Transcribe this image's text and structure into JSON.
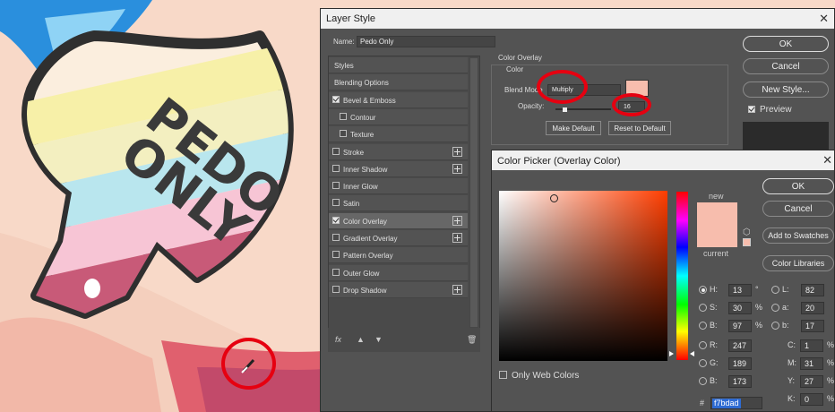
{
  "artwork": {
    "sign_text_line1": "PEDO",
    "sign_text_line2": "ONLY"
  },
  "layer_style": {
    "title": "Layer Style",
    "name_label": "Name:",
    "name_value": "Pedo Only",
    "styles": [
      {
        "label": "Styles",
        "checkbox": false,
        "checked": false,
        "plus": false,
        "active": false,
        "indent": false
      },
      {
        "label": "Blending Options",
        "checkbox": false,
        "checked": false,
        "plus": false,
        "active": false,
        "indent": false
      },
      {
        "label": "Bevel & Emboss",
        "checkbox": true,
        "checked": true,
        "plus": false,
        "active": false,
        "indent": false
      },
      {
        "label": "Contour",
        "checkbox": true,
        "checked": false,
        "plus": false,
        "active": false,
        "indent": true
      },
      {
        "label": "Texture",
        "checkbox": true,
        "checked": false,
        "plus": false,
        "active": false,
        "indent": true
      },
      {
        "label": "Stroke",
        "checkbox": true,
        "checked": false,
        "plus": true,
        "active": false,
        "indent": false
      },
      {
        "label": "Inner Shadow",
        "checkbox": true,
        "checked": false,
        "plus": true,
        "active": false,
        "indent": false
      },
      {
        "label": "Inner Glow",
        "checkbox": true,
        "checked": false,
        "plus": false,
        "active": false,
        "indent": false
      },
      {
        "label": "Satin",
        "checkbox": true,
        "checked": false,
        "plus": false,
        "active": false,
        "indent": false
      },
      {
        "label": "Color Overlay",
        "checkbox": true,
        "checked": true,
        "plus": true,
        "active": true,
        "indent": false
      },
      {
        "label": "Gradient Overlay",
        "checkbox": true,
        "checked": false,
        "plus": true,
        "active": false,
        "indent": false
      },
      {
        "label": "Pattern Overlay",
        "checkbox": true,
        "checked": false,
        "plus": false,
        "active": false,
        "indent": false
      },
      {
        "label": "Outer Glow",
        "checkbox": true,
        "checked": false,
        "plus": false,
        "active": false,
        "indent": false
      },
      {
        "label": "Drop Shadow",
        "checkbox": true,
        "checked": false,
        "plus": true,
        "active": false,
        "indent": false
      }
    ],
    "fx_label": "fx",
    "section_title": "Color Overlay",
    "group_title": "Color",
    "blend_mode_label": "Blend Mode",
    "blend_mode_value": "Multiply",
    "overlay_color": "#f7bdad",
    "opacity_label": "Opacity:",
    "opacity_value": "16",
    "opacity_level": 0.16,
    "make_default": "Make Default",
    "reset_default": "Reset to Default",
    "buttons": {
      "ok": "OK",
      "cancel": "Cancel",
      "new_style": "New Style..."
    },
    "preview_label": "Preview",
    "preview_checked": true
  },
  "color_picker": {
    "title": "Color Picker (Overlay Color)",
    "new_label": "new",
    "current_label": "current",
    "new_color": "#f7bdad",
    "current_color": "#f7bdad",
    "buttons": {
      "ok": "OK",
      "cancel": "Cancel",
      "add_to_swatches": "Add to Swatches",
      "color_libraries": "Color Libraries"
    },
    "hsb": [
      {
        "label": "H:",
        "value": "13",
        "unit": "°",
        "selected": true
      },
      {
        "label": "S:",
        "value": "30",
        "unit": "%",
        "selected": false
      },
      {
        "label": "B:",
        "value": "97",
        "unit": "%",
        "selected": false
      }
    ],
    "rgb": [
      {
        "label": "R:",
        "value": "247"
      },
      {
        "label": "G:",
        "value": "189"
      },
      {
        "label": "B:",
        "value": "173"
      }
    ],
    "lab": [
      {
        "label": "L:",
        "value": "82"
      },
      {
        "label": "a:",
        "value": "20"
      },
      {
        "label": "b:",
        "value": "17"
      }
    ],
    "cmyk": [
      {
        "label": "C:",
        "value": "1",
        "unit": "%"
      },
      {
        "label": "M:",
        "value": "31",
        "unit": "%"
      },
      {
        "label": "Y:",
        "value": "27",
        "unit": "%"
      },
      {
        "label": "K:",
        "value": "0",
        "unit": "%"
      }
    ],
    "hex_label": "#",
    "hex_value": "f7bdad",
    "only_web_colors": "Only Web Colors"
  }
}
